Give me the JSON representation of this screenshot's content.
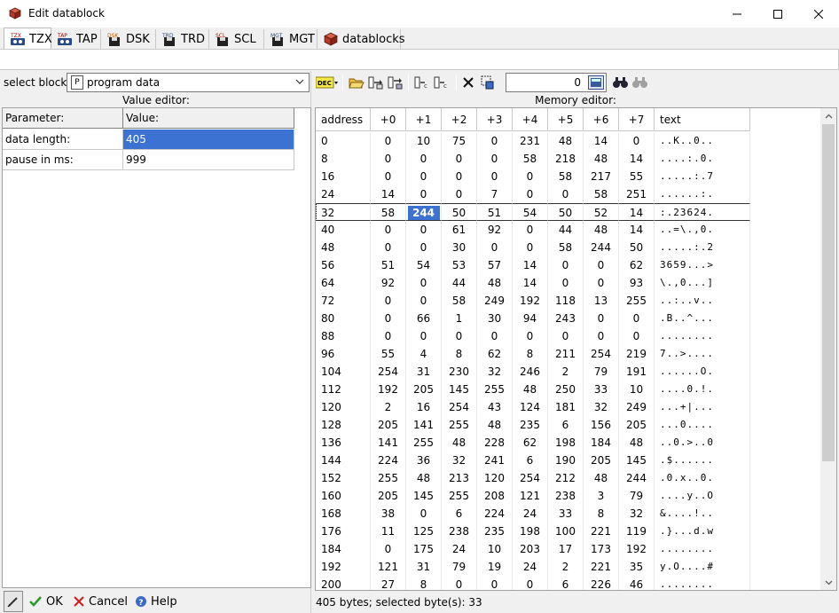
{
  "window": {
    "title": "Edit datablock"
  },
  "tabs": [
    {
      "label": "TZX",
      "badge": "TZX",
      "active": true
    },
    {
      "label": "TAP",
      "badge": "TAP"
    },
    {
      "label": "DSK",
      "badge": "DSK"
    },
    {
      "label": "TRD",
      "badge": "TRD"
    },
    {
      "label": "SCL",
      "badge": "SCL"
    },
    {
      "label": "MGT",
      "badge": "MGT"
    },
    {
      "label": "datablocks"
    }
  ],
  "left": {
    "select_label": "select block:",
    "select_value": "program data",
    "value_editor_title": "Value editor:",
    "grid": {
      "headers": [
        "Parameter:",
        "Value:"
      ],
      "rows": [
        {
          "param": "data length:",
          "value": "405"
        },
        {
          "param": "pause in ms:",
          "value": "999"
        }
      ]
    },
    "buttons": {
      "ok": "OK",
      "cancel": "Cancel",
      "help": "Help"
    }
  },
  "right": {
    "format_label": "DEC",
    "address_value": "0",
    "memory_title": "Memory editor:",
    "columns": [
      "address",
      "+0",
      "+1",
      "+2",
      "+3",
      "+4",
      "+5",
      "+6",
      "+7",
      "text"
    ],
    "rows": [
      {
        "addr": "0",
        "bytes": [
          "0",
          "10",
          "75",
          "0",
          "231",
          "48",
          "14",
          "0"
        ],
        "text": "..K..0.."
      },
      {
        "addr": "8",
        "bytes": [
          "0",
          "0",
          "0",
          "0",
          "58",
          "218",
          "48",
          "14"
        ],
        "text": "....:.0."
      },
      {
        "addr": "16",
        "bytes": [
          "0",
          "0",
          "0",
          "0",
          "0",
          "58",
          "217",
          "55"
        ],
        "text": ".....:.7"
      },
      {
        "addr": "24",
        "bytes": [
          "14",
          "0",
          "0",
          "7",
          "0",
          "0",
          "58",
          "251"
        ],
        "text": "......:."
      },
      {
        "addr": "32",
        "bytes": [
          "58",
          "244",
          "50",
          "51",
          "54",
          "50",
          "52",
          "14"
        ],
        "text": ":.23624."
      },
      {
        "addr": "40",
        "bytes": [
          "0",
          "0",
          "61",
          "92",
          "0",
          "44",
          "48",
          "14"
        ],
        "text": "..=\\.,0."
      },
      {
        "addr": "48",
        "bytes": [
          "0",
          "0",
          "30",
          "0",
          "0",
          "58",
          "244",
          "50"
        ],
        "text": ".....:.2"
      },
      {
        "addr": "56",
        "bytes": [
          "51",
          "54",
          "53",
          "57",
          "14",
          "0",
          "0",
          "62"
        ],
        "text": "3659...>"
      },
      {
        "addr": "64",
        "bytes": [
          "92",
          "0",
          "44",
          "48",
          "14",
          "0",
          "0",
          "93"
        ],
        "text": "\\.,0...]"
      },
      {
        "addr": "72",
        "bytes": [
          "0",
          "0",
          "58",
          "249",
          "192",
          "118",
          "13",
          "255"
        ],
        "text": "..:..v.."
      },
      {
        "addr": "80",
        "bytes": [
          "0",
          "66",
          "1",
          "30",
          "94",
          "243",
          "0",
          "0"
        ],
        "text": ".B..^..."
      },
      {
        "addr": "88",
        "bytes": [
          "0",
          "0",
          "0",
          "0",
          "0",
          "0",
          "0",
          "0"
        ],
        "text": "........"
      },
      {
        "addr": "96",
        "bytes": [
          "55",
          "4",
          "8",
          "62",
          "8",
          "211",
          "254",
          "219"
        ],
        "text": "7..>...."
      },
      {
        "addr": "104",
        "bytes": [
          "254",
          "31",
          "230",
          "32",
          "246",
          "2",
          "79",
          "191"
        ],
        "text": "......O."
      },
      {
        "addr": "112",
        "bytes": [
          "192",
          "205",
          "145",
          "255",
          "48",
          "250",
          "33",
          "10"
        ],
        "text": "....0.!."
      },
      {
        "addr": "120",
        "bytes": [
          "2",
          "16",
          "254",
          "43",
          "124",
          "181",
          "32",
          "249"
        ],
        "text": "...+|..."
      },
      {
        "addr": "128",
        "bytes": [
          "205",
          "141",
          "255",
          "48",
          "235",
          "6",
          "156",
          "205"
        ],
        "text": "...0...."
      },
      {
        "addr": "136",
        "bytes": [
          "141",
          "255",
          "48",
          "228",
          "62",
          "198",
          "184",
          "48"
        ],
        "text": "..0.>..0"
      },
      {
        "addr": "144",
        "bytes": [
          "224",
          "36",
          "32",
          "241",
          "6",
          "190",
          "205",
          "145"
        ],
        "text": ".$......"
      },
      {
        "addr": "152",
        "bytes": [
          "255",
          "48",
          "213",
          "120",
          "254",
          "212",
          "48",
          "244"
        ],
        "text": ".0.x..0."
      },
      {
        "addr": "160",
        "bytes": [
          "205",
          "145",
          "255",
          "208",
          "121",
          "238",
          "3",
          "79"
        ],
        "text": "....y..O"
      },
      {
        "addr": "168",
        "bytes": [
          "38",
          "0",
          "6",
          "224",
          "24",
          "33",
          "8",
          "32"
        ],
        "text": "&....!.."
      },
      {
        "addr": "176",
        "bytes": [
          "11",
          "125",
          "238",
          "235",
          "198",
          "100",
          "221",
          "119"
        ],
        "text": ".}...d.w"
      },
      {
        "addr": "184",
        "bytes": [
          "0",
          "175",
          "24",
          "10",
          "203",
          "17",
          "173",
          "192"
        ],
        "text": "........"
      },
      {
        "addr": "192",
        "bytes": [
          "121",
          "31",
          "79",
          "19",
          "24",
          "2",
          "221",
          "35"
        ],
        "text": "y.O....#"
      },
      {
        "addr": "200",
        "bytes": [
          "27",
          "8",
          "0",
          "0",
          "0",
          "6",
          "226",
          "46"
        ],
        "text": "........"
      }
    ],
    "status": "405 bytes;   selected byte(s): 33"
  },
  "colors": {
    "selection": "#3c73d3"
  }
}
